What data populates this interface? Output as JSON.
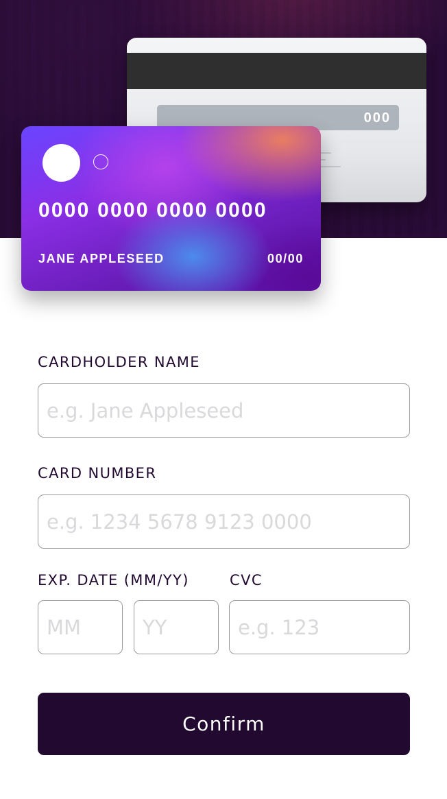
{
  "card_preview": {
    "back": {
      "cvc": "000"
    },
    "front": {
      "number": "0000 0000 0000 0000",
      "holder_name": "JANE APPLESEED",
      "expiry": "00/00"
    }
  },
  "form": {
    "cardholder_name": {
      "label": "CARDHOLDER NAME",
      "placeholder": "e.g. Jane Appleseed",
      "value": ""
    },
    "card_number": {
      "label": "CARD NUMBER",
      "placeholder": "e.g. 1234 5678 9123 0000",
      "value": ""
    },
    "exp_date": {
      "label": "EXP. DATE (MM/YY)",
      "month_placeholder": "MM",
      "year_placeholder": "YY"
    },
    "cvc": {
      "label": "CVC",
      "placeholder": "e.g. 123",
      "value": ""
    },
    "confirm_label": "Confirm"
  },
  "colors": {
    "hero_background": "#2a0c38",
    "primary_dark": "#21092f",
    "input_border": "#9a9a9f",
    "placeholder": "#d9d9dc",
    "white": "#ffffff"
  }
}
